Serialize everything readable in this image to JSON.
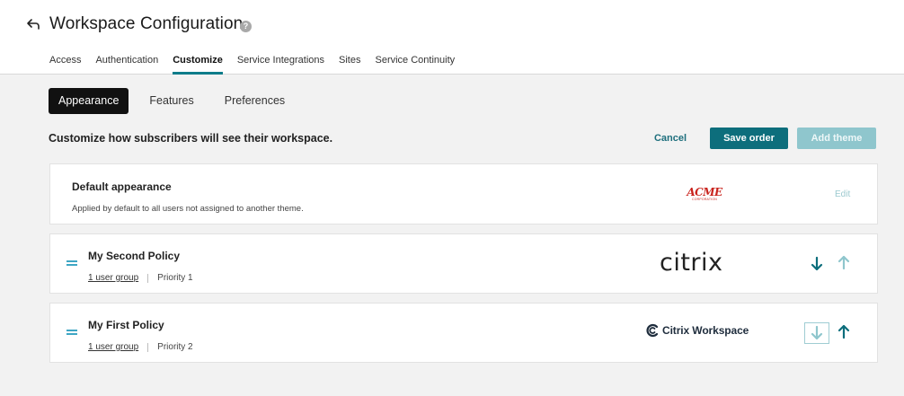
{
  "header": {
    "title": "Workspace Configuration",
    "help_glyph": "?",
    "tabs": [
      {
        "label": "Access"
      },
      {
        "label": "Authentication"
      },
      {
        "label": "Customize"
      },
      {
        "label": "Service Integrations"
      },
      {
        "label": "Sites"
      },
      {
        "label": "Service Continuity"
      }
    ],
    "active_tab": "Customize"
  },
  "subtabs": [
    {
      "label": "Appearance"
    },
    {
      "label": "Features"
    },
    {
      "label": "Preferences"
    }
  ],
  "active_subtab": "Appearance",
  "section": {
    "heading": "Customize how subscribers will see their workspace.",
    "cancel_label": "Cancel",
    "save_label": "Save order",
    "add_theme_label": "Add theme"
  },
  "default_appearance": {
    "title": "Default appearance",
    "description": "Applied by default to all users not assigned to another theme.",
    "logo_text": "ACME",
    "logo_subtext": "CORPORATION",
    "edit_label": "Edit"
  },
  "policies": [
    {
      "title": "My Second Policy",
      "user_groups": "1 user group",
      "priority": "Priority 1",
      "logo_text": "citrix"
    },
    {
      "title": "My First Policy",
      "user_groups": "1 user group",
      "priority": "Priority 2",
      "logo_text": "Citrix Workspace"
    }
  ],
  "colors": {
    "accent": "#0d6e7c",
    "accent_disabled": "#8fc6cd",
    "drag_handle": "#3ea6c4",
    "logo_red": "#c9231d"
  },
  "icons": {
    "back": "arrow-back-icon",
    "help": "help-icon",
    "drag": "drag-handle-icon",
    "move_down": "arrow-down-icon",
    "move_up": "arrow-up-icon"
  }
}
